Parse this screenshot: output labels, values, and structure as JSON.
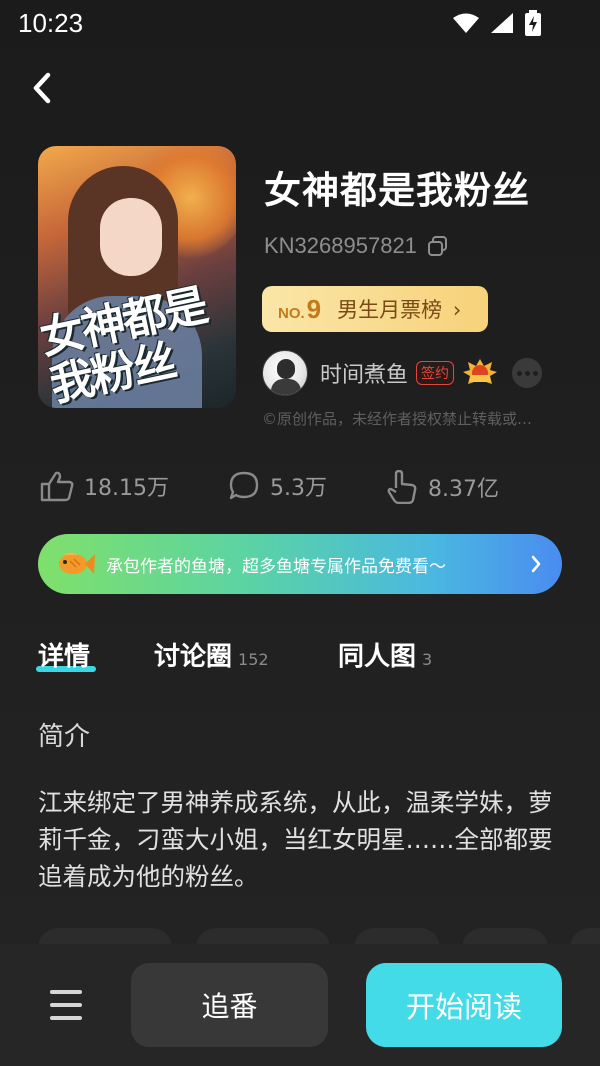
{
  "status_bar": {
    "time": "10:23"
  },
  "book": {
    "title": "女神都是我粉丝",
    "id": "KN3268957821",
    "cover_title_text": "女神都是\n我粉丝"
  },
  "rank": {
    "no_label": "NO.",
    "number": "9",
    "label": "男生月票榜",
    "arrow": "›"
  },
  "author": {
    "name": "时间煮鱼",
    "signed_badge": "签约"
  },
  "copyright": "©原创作品，未经作者授权禁止转载或…",
  "stats": {
    "likes": "18.15万",
    "comments": "5.3万",
    "views": "8.37亿"
  },
  "fish_banner": {
    "text": "承包作者的鱼塘，超多鱼塘专属作品免费看～"
  },
  "tabs": [
    {
      "label": "详情",
      "count": ""
    },
    {
      "label": "讨论圈",
      "count": "152"
    },
    {
      "label": "同人图",
      "count": "3"
    }
  ],
  "intro": {
    "heading": "简介",
    "body": "江来绑定了男神养成系统，从此，温柔学妹，萝莉千金，刁蛮大小姐，当红女明星……全部都要追着成为他的粉丝。"
  },
  "bottom_bar": {
    "follow_label": "追番",
    "read_label": "开始阅读"
  },
  "colors": {
    "accent": "#44dbe9",
    "rank_gold": "#f6d27a",
    "signed_red": "#e4453a"
  }
}
